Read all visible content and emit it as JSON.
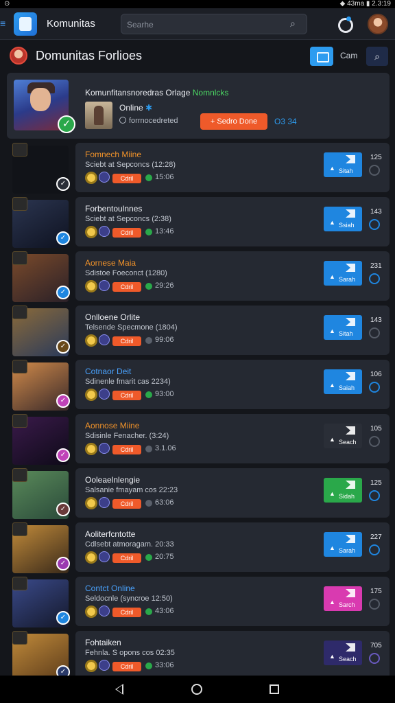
{
  "status_bar": {
    "left": "⊙",
    "right": "◆ 43ma ▮ 2.3:19"
  },
  "header": {
    "app_title": "Komunitas",
    "search_placeholder": "Searhe"
  },
  "section": {
    "title": "Domunitas Forlioes",
    "button_label": "Cam"
  },
  "featured": {
    "title_main": "Komunfitansnoredras Orlage ",
    "title_green": "Nomnlcks",
    "status": "Online",
    "meta": "forrnocedreted",
    "action_label": "+ Sedro Done",
    "count": "O3 34"
  },
  "rows": [
    {
      "title": "Fomnech Miine",
      "sub": "Sciebt at Sepconcs (12:28)",
      "pill": "Cdril",
      "time": "15:06",
      "action": "Sitah",
      "num": "125",
      "action_color": "#1f86e0",
      "title_color": "#f0922a",
      "thumb": [
        "#111318",
        "#111318"
      ],
      "badge_color": "#2a2e37",
      "dot_color": "#2aa84a",
      "circ_color": "#555b66"
    },
    {
      "title": "Forbentoulnnes",
      "sub": "Sciebt at Sepconcs (2:38)",
      "pill": "Cdril",
      "time": "13:46",
      "action": "Ssiah",
      "num": "143",
      "action_color": "#1f86e0",
      "title_color": "#eef0f5",
      "thumb": [
        "#2b3550",
        "#0e1220"
      ],
      "badge_color": "#1f86e0",
      "dot_color": "#2aa84a",
      "circ_color": "#1f86e0"
    },
    {
      "title": "Aornese Maia",
      "sub": "Sdistoe Foeconct (1280)",
      "pill": "Cdril",
      "time": "29:26",
      "action": "Sarah",
      "num": "231",
      "action_color": "#1f86e0",
      "title_color": "#f0922a",
      "thumb": [
        "#7a4a2a",
        "#2a2028"
      ],
      "badge_color": "#1f86e0",
      "dot_color": "#2aa84a",
      "circ_color": "#1f86e0"
    },
    {
      "title": "Onlloene Orlite",
      "sub": "Telsende Specmone (1804)",
      "pill": "Cdril",
      "time": "99:06",
      "action": "Sitah",
      "num": "143",
      "action_color": "#1f86e0",
      "title_color": "#eef0f5",
      "thumb": [
        "#8a6a3a",
        "#2a3a5a"
      ],
      "badge_color": "#6a4a1a",
      "dot_color": "#5a606b",
      "circ_color": "#555b66"
    },
    {
      "title": "Cotnaor Deit",
      "sub": "Sdinenle fmarit cas 2234)",
      "pill": "Cdril",
      "time": "93:00",
      "action": "Saiah",
      "num": "106",
      "action_color": "#1f86e0",
      "title_color": "#4aa3ff",
      "thumb": [
        "#d08a4a",
        "#3a2a2a"
      ],
      "badge_color": "#c043b8",
      "dot_color": "#2aa84a",
      "circ_color": "#1f86e0"
    },
    {
      "title": "Aonnose Miine",
      "sub": "Sdisinle Fenacher. (3:24)",
      "pill": "Cdril",
      "time": "3.1.06",
      "action": "Seach",
      "num": "105",
      "action_color": "#2a2e37",
      "title_color": "#f0922a",
      "thumb": [
        "#3a1a4a",
        "#0e0a18"
      ],
      "badge_color": "#c043b8",
      "dot_color": "#5a606b",
      "circ_color": "#555b66"
    },
    {
      "title": "Ooleaelnlengie",
      "sub": "Salsanie fmayam cos 22:23",
      "pill": "Cdril",
      "time": "63:06",
      "action": "Sidah",
      "num": "125",
      "action_color": "#2aa84a",
      "title_color": "#eef0f5",
      "thumb": [
        "#5a8a5a",
        "#2a4a3a"
      ],
      "badge_color": "#6a3a3a",
      "dot_color": "#5a606b",
      "circ_color": "#1f86e0"
    },
    {
      "title": "Aoliterfcntotte",
      "sub": "Cdlsebt atmoragam. 20:33",
      "pill": "Cdril",
      "time": "20:75",
      "action": "Sarah",
      "num": "227",
      "action_color": "#1f86e0",
      "title_color": "#eef0f5",
      "thumb": [
        "#c08a3a",
        "#3a2a1a"
      ],
      "badge_color": "#9a3ab0",
      "dot_color": "#2aa84a",
      "circ_color": "#1f86e0"
    },
    {
      "title": "Contct Online",
      "sub": "Seldocnle (syncroe 12:50)",
      "pill": "Cdril",
      "time": "43:06",
      "action": "Sarch",
      "num": "175",
      "action_color": "#d93ab0",
      "title_color": "#4aa3ff",
      "thumb": [
        "#3a4a8a",
        "#14182a"
      ],
      "badge_color": "#1f86e0",
      "dot_color": "#2aa84a",
      "circ_color": "#555b66"
    },
    {
      "title": "Fohtaiken",
      "sub": "Fehnla. S opons cos 02:35",
      "pill": "Cdril",
      "time": "33:06",
      "action": "Seach",
      "num": "705",
      "action_color": "#2e2a6a",
      "title_color": "#eef0f5",
      "thumb": [
        "#c08a3a",
        "#5a3a1a"
      ],
      "badge_color": "#2a3a6a",
      "dot_color": "#2aa84a",
      "circ_color": "#6a5ac0"
    }
  ]
}
